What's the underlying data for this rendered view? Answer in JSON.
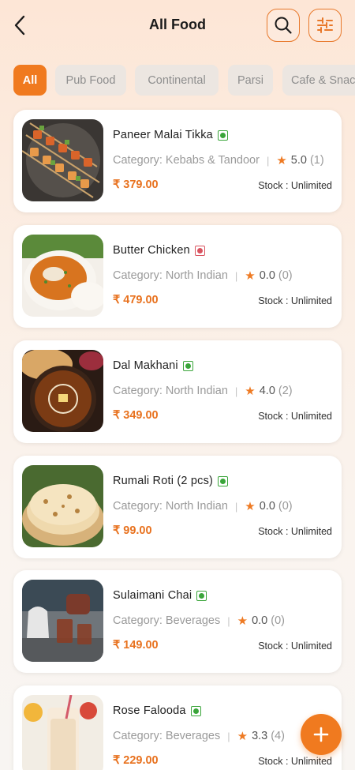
{
  "header": {
    "title": "All Food",
    "back_icon": "chevron-left-icon",
    "search_icon": "search-icon",
    "filter_icon": "sliders-icon"
  },
  "categories": [
    "All",
    "Pub Food",
    "Continental",
    "Parsi",
    "Cafe & Snacks"
  ],
  "colors": {
    "accent": "#f07a1f",
    "veg": "#3aa53a",
    "nonveg": "#d9535f"
  },
  "items": [
    {
      "name": "Paneer Malai Tikka",
      "type": "veg",
      "category": "Category: Kebabs & Tandoor",
      "rating": "5.0",
      "count": "(1)",
      "price": "₹ 379.00",
      "stock": "Stock : Unlimited"
    },
    {
      "name": "Butter Chicken",
      "type": "nonveg",
      "category": "Category: North Indian",
      "rating": "0.0",
      "count": "(0)",
      "price": "₹ 479.00",
      "stock": "Stock : Unlimited"
    },
    {
      "name": "Dal Makhani",
      "type": "veg",
      "category": "Category: North Indian",
      "rating": "4.0",
      "count": "(2)",
      "price": "₹ 349.00",
      "stock": "Stock : Unlimited"
    },
    {
      "name": "Rumali Roti (2 pcs)",
      "type": "veg",
      "category": "Category: North Indian",
      "rating": "0.0",
      "count": "(0)",
      "price": "₹ 99.00",
      "stock": "Stock : Unlimited"
    },
    {
      "name": "Sulaimani Chai",
      "type": "veg",
      "category": "Category: Beverages",
      "rating": "0.0",
      "count": "(0)",
      "price": "₹ 149.00",
      "stock": "Stock : Unlimited"
    },
    {
      "name": "Rose Falooda",
      "type": "veg",
      "category": "Category: Beverages",
      "rating": "3.3",
      "count": "(4)",
      "price": "₹ 229.00",
      "stock": "Stock : Unlimited"
    }
  ],
  "fab": {
    "icon": "plus-icon"
  }
}
